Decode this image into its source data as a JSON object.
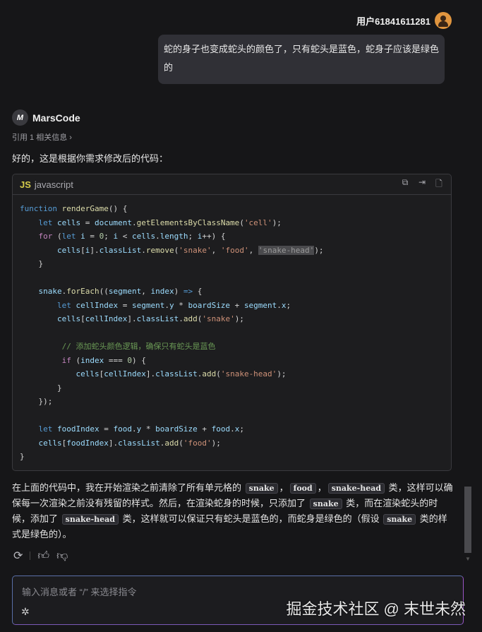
{
  "user": {
    "name": "用户61841611281",
    "message": "蛇的身子也变成蛇头的颜色了，只有蛇头是蓝色，蛇身子应该是绿色的"
  },
  "bot": {
    "logo": "M",
    "name": "MarsCode",
    "refs": "引用 1 相关信息 ›",
    "intro": "好的，这是根据你需求修改后的代码：",
    "code_block": {
      "badge": "JS",
      "language": "javascript",
      "tools": [
        "copy-icon",
        "insert-icon",
        "new-file-icon"
      ],
      "lines": [
        [
          [
            "k",
            "function"
          ],
          [
            "p",
            " "
          ],
          [
            "f",
            "renderGame"
          ],
          [
            "p",
            "() {"
          ]
        ],
        [
          [
            "p",
            "    "
          ],
          [
            "k",
            "let"
          ],
          [
            "p",
            " "
          ],
          [
            "v",
            "cells"
          ],
          [
            "p",
            " = "
          ],
          [
            "v",
            "document"
          ],
          [
            "p",
            "."
          ],
          [
            "f",
            "getElementsByClassName"
          ],
          [
            "p",
            "("
          ],
          [
            "s",
            "'cell'"
          ],
          [
            "p",
            ");"
          ]
        ],
        [
          [
            "p",
            "    "
          ],
          [
            "c",
            "for"
          ],
          [
            "p",
            " ("
          ],
          [
            "k",
            "let"
          ],
          [
            "p",
            " "
          ],
          [
            "v",
            "i"
          ],
          [
            "p",
            " = "
          ],
          [
            "n",
            "0"
          ],
          [
            "p",
            "; "
          ],
          [
            "v",
            "i"
          ],
          [
            "p",
            " < "
          ],
          [
            "v",
            "cells"
          ],
          [
            "p",
            "."
          ],
          [
            "v",
            "length"
          ],
          [
            "p",
            "; "
          ],
          [
            "v",
            "i"
          ],
          [
            "p",
            "++) {"
          ]
        ],
        [
          [
            "p",
            "        "
          ],
          [
            "v",
            "cells"
          ],
          [
            "p",
            "["
          ],
          [
            "v",
            "i"
          ],
          [
            "p",
            "]."
          ],
          [
            "v",
            "classList"
          ],
          [
            "p",
            "."
          ],
          [
            "f",
            "remove"
          ],
          [
            "p",
            "("
          ],
          [
            "s",
            "'snake'"
          ],
          [
            "p",
            ", "
          ],
          [
            "s",
            "'food'"
          ],
          [
            "p",
            ", "
          ],
          [
            "h",
            "'snake-head'"
          ],
          [
            "p",
            ");"
          ]
        ],
        [
          [
            "p",
            "    }"
          ]
        ],
        [
          [
            "p",
            " "
          ]
        ],
        [
          [
            "p",
            "    "
          ],
          [
            "v",
            "snake"
          ],
          [
            "p",
            "."
          ],
          [
            "f",
            "forEach"
          ],
          [
            "p",
            "(("
          ],
          [
            "v",
            "segment"
          ],
          [
            "p",
            ", "
          ],
          [
            "v",
            "index"
          ],
          [
            "p",
            ") "
          ],
          [
            "k",
            "=>"
          ],
          [
            "p",
            " {"
          ]
        ],
        [
          [
            "p",
            "        "
          ],
          [
            "k",
            "let"
          ],
          [
            "p",
            " "
          ],
          [
            "v",
            "cellIndex"
          ],
          [
            "p",
            " = "
          ],
          [
            "v",
            "segment"
          ],
          [
            "p",
            "."
          ],
          [
            "v",
            "y"
          ],
          [
            "p",
            " * "
          ],
          [
            "v",
            "boardSize"
          ],
          [
            "p",
            " + "
          ],
          [
            "v",
            "segment"
          ],
          [
            "p",
            "."
          ],
          [
            "v",
            "x"
          ],
          [
            "p",
            ";"
          ]
        ],
        [
          [
            "p",
            "        "
          ],
          [
            "v",
            "cells"
          ],
          [
            "p",
            "["
          ],
          [
            "v",
            "cellIndex"
          ],
          [
            "p",
            "]."
          ],
          [
            "v",
            "classList"
          ],
          [
            "p",
            "."
          ],
          [
            "f",
            "add"
          ],
          [
            "p",
            "("
          ],
          [
            "s",
            "'snake'"
          ],
          [
            "p",
            ");"
          ]
        ],
        [
          [
            "p",
            " "
          ]
        ],
        [
          [
            "p",
            "         "
          ],
          [
            "m",
            "// 添加蛇头颜色逻辑，确保只有蛇头是蓝色"
          ]
        ],
        [
          [
            "p",
            "         "
          ],
          [
            "c",
            "if"
          ],
          [
            "p",
            " ("
          ],
          [
            "v",
            "index"
          ],
          [
            "p",
            " === "
          ],
          [
            "n",
            "0"
          ],
          [
            "p",
            ") {"
          ]
        ],
        [
          [
            "p",
            "            "
          ],
          [
            "v",
            "cells"
          ],
          [
            "p",
            "["
          ],
          [
            "v",
            "cellIndex"
          ],
          [
            "p",
            "]."
          ],
          [
            "v",
            "classList"
          ],
          [
            "p",
            "."
          ],
          [
            "f",
            "add"
          ],
          [
            "p",
            "("
          ],
          [
            "s",
            "'snake-head'"
          ],
          [
            "p",
            ");"
          ]
        ],
        [
          [
            "p",
            "        }"
          ]
        ],
        [
          [
            "p",
            "    });"
          ]
        ],
        [
          [
            "p",
            " "
          ]
        ],
        [
          [
            "p",
            "    "
          ],
          [
            "k",
            "let"
          ],
          [
            "p",
            " "
          ],
          [
            "v",
            "foodIndex"
          ],
          [
            "p",
            " = "
          ],
          [
            "v",
            "food"
          ],
          [
            "p",
            "."
          ],
          [
            "v",
            "y"
          ],
          [
            "p",
            " * "
          ],
          [
            "v",
            "boardSize"
          ],
          [
            "p",
            " + "
          ],
          [
            "v",
            "food"
          ],
          [
            "p",
            "."
          ],
          [
            "v",
            "x"
          ],
          [
            "p",
            ";"
          ]
        ],
        [
          [
            "p",
            "    "
          ],
          [
            "v",
            "cells"
          ],
          [
            "p",
            "["
          ],
          [
            "v",
            "foodIndex"
          ],
          [
            "p",
            "]."
          ],
          [
            "v",
            "classList"
          ],
          [
            "p",
            "."
          ],
          [
            "f",
            "add"
          ],
          [
            "p",
            "("
          ],
          [
            "s",
            "'food'"
          ],
          [
            "p",
            ");"
          ]
        ],
        [
          [
            "p",
            "}"
          ]
        ]
      ]
    },
    "explanation": [
      [
        "t",
        "在上面的代码中，我在开始渲染之前清除了所有单元格的 "
      ],
      [
        "c",
        "snake"
      ],
      [
        "t",
        "，"
      ],
      [
        "c",
        "food"
      ],
      [
        "t",
        "，"
      ],
      [
        "c",
        "snake-head"
      ],
      [
        "t",
        " 类，这样可以确保每一次渲染之前没有残留的样式。然后，在渲染蛇身的时候，只添加了 "
      ],
      [
        "c",
        "snake"
      ],
      [
        "t",
        " 类，而在渲染蛇头的时候，添加了 "
      ],
      [
        "c",
        "snake-head"
      ],
      [
        "t",
        " 类，这样就可以保证只有蛇头是蓝色的，而蛇身是绿色的（假设 "
      ],
      [
        "c",
        "snake"
      ],
      [
        "t",
        " 类的样式是绿色的）。"
      ]
    ],
    "actions": [
      "regenerate-icon",
      "thumbs-up-icon",
      "thumbs-down-icon"
    ]
  },
  "input": {
    "placeholder": "输入消息或者 “/” 来选择指令"
  },
  "watermark": "掘金技术社区 @ 末世未然"
}
